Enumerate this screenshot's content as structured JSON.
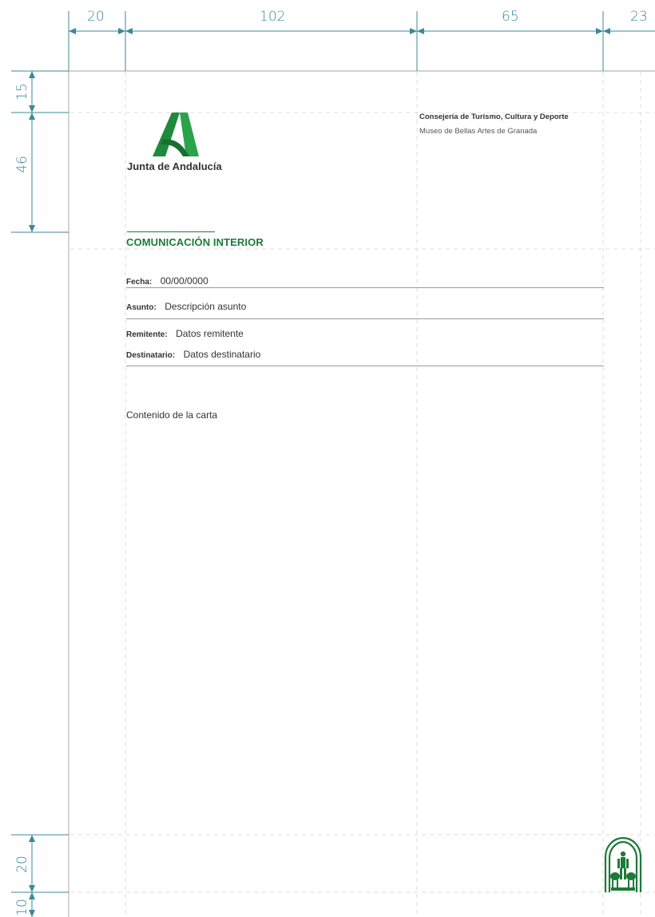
{
  "dimensions": {
    "top_widths": [
      "20",
      "102",
      "65",
      "23"
    ],
    "left_heights_top": [
      "15",
      "46"
    ],
    "left_heights_bottom": [
      "20",
      "10"
    ]
  },
  "colors": {
    "guide": "#3a8a9a",
    "brand_green": "#1d7a38",
    "rule_gray": "#9a9a9a",
    "dash_gray": "#dcdcdc"
  },
  "header": {
    "logo_text": "Junta de Andalucía",
    "logo_icon": "junta-a-logo-icon",
    "org_name": "Consejería de Turismo, Cultura y Deporte",
    "org_sub": "Museo de Bellas Artes de Granada"
  },
  "memo": {
    "title": "COMUNICACIÓN INTERIOR",
    "fecha_label": "Fecha:",
    "fecha_value": "00/00/0000",
    "asunto_label": "Asunto:",
    "asunto_value": "Descripción asunto",
    "remitente_label": "Remitente:",
    "remitente_value": "Datos remitente",
    "destinatario_label": "Destinatario:",
    "destinatario_value": "Datos destinatario",
    "content": "Contenido de la carta"
  },
  "footer": {
    "emblem_icon": "andalucia-shield-emblem-icon"
  }
}
